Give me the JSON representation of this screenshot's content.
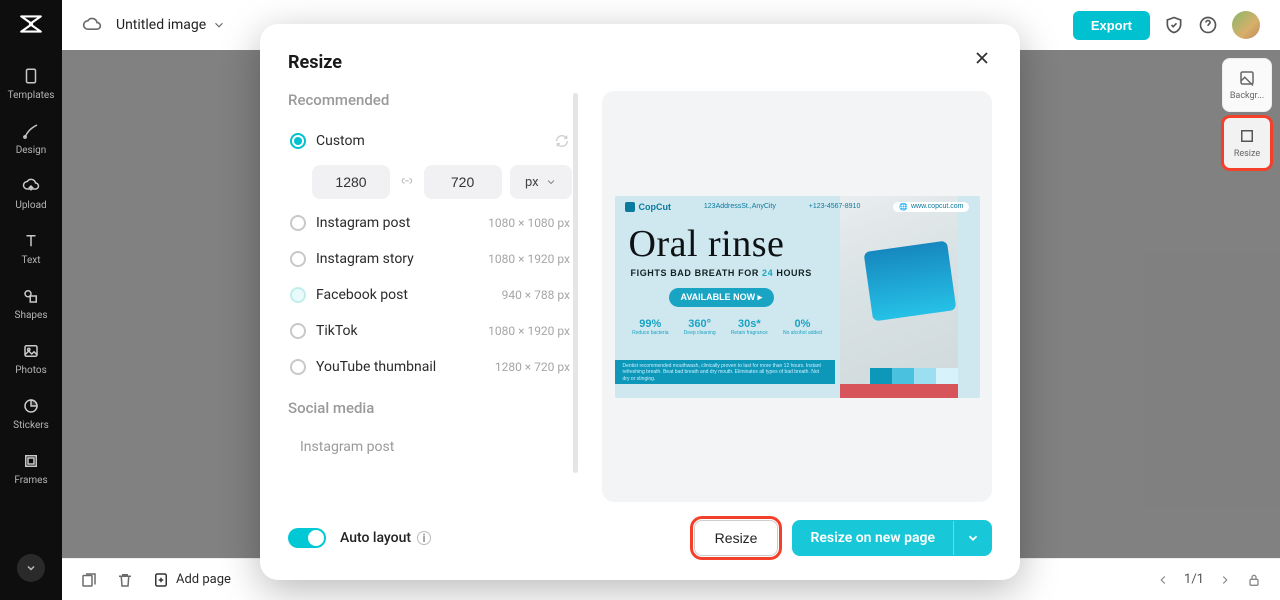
{
  "header": {
    "title": "Untitled image",
    "export_label": "Export"
  },
  "left_rail": {
    "items": [
      {
        "icon": "templates",
        "label": "Templates"
      },
      {
        "icon": "design",
        "label": "Design"
      },
      {
        "icon": "upload",
        "label": "Upload"
      },
      {
        "icon": "text",
        "label": "Text"
      },
      {
        "icon": "shapes",
        "label": "Shapes"
      },
      {
        "icon": "photos",
        "label": "Photos"
      },
      {
        "icon": "stickers",
        "label": "Stickers"
      },
      {
        "icon": "frames",
        "label": "Frames"
      }
    ]
  },
  "right_rail": {
    "items": [
      {
        "label": "Backgr..."
      },
      {
        "label": "Resize"
      }
    ]
  },
  "bottom": {
    "add_page_label": "Add page",
    "pager": "1/1"
  },
  "modal": {
    "title": "Resize",
    "section_recommended": "Recommended",
    "custom_label": "Custom",
    "width": "1280",
    "height": "720",
    "unit": "px",
    "presets": [
      {
        "label": "Instagram post",
        "dim": "1080 × 1080 px"
      },
      {
        "label": "Instagram story",
        "dim": "1080 × 1920 px"
      },
      {
        "label": "Facebook post",
        "dim": "940 × 788 px"
      },
      {
        "label": "TikTok",
        "dim": "1080 × 1920 px"
      },
      {
        "label": "YouTube thumbnail",
        "dim": "1280 × 720 px"
      }
    ],
    "section_social": "Social media",
    "social_items": [
      "Instagram post"
    ],
    "auto_layout_label": "Auto layout",
    "resize_btn": "Resize",
    "resize_new_btn": "Resize on new page"
  },
  "preview": {
    "brand": "CopCut",
    "address": "123AddressSt.,AnyCity",
    "phone": "+123-4567-8910",
    "url": "www.copcut.com",
    "headline": "Oral rinse",
    "subline_pre": "FIGHTS BAD BREATH FOR ",
    "subline_hours": "24",
    "subline_post": " HOURS",
    "cta": "AVAILABLE NOW ▸",
    "stats": [
      {
        "v": "99%",
        "l": "Reduce bacteria"
      },
      {
        "v": "360°",
        "l": "Deep cleaning"
      },
      {
        "v": "30s*",
        "l": "Retain fragrance"
      },
      {
        "v": "0%",
        "l": "No alcohol added"
      }
    ],
    "footnote": "Dentist recommended mouthwash, clinically proven to last for more than 12 hours. Instant refreshing breath. Beat bad breath and dry mouth. Eliminates all types of bad breath. Not dry or stinging.",
    "swatches": [
      "#0d98ba",
      "#4ac1df",
      "#9cdff1",
      "#d8f2fb"
    ]
  }
}
